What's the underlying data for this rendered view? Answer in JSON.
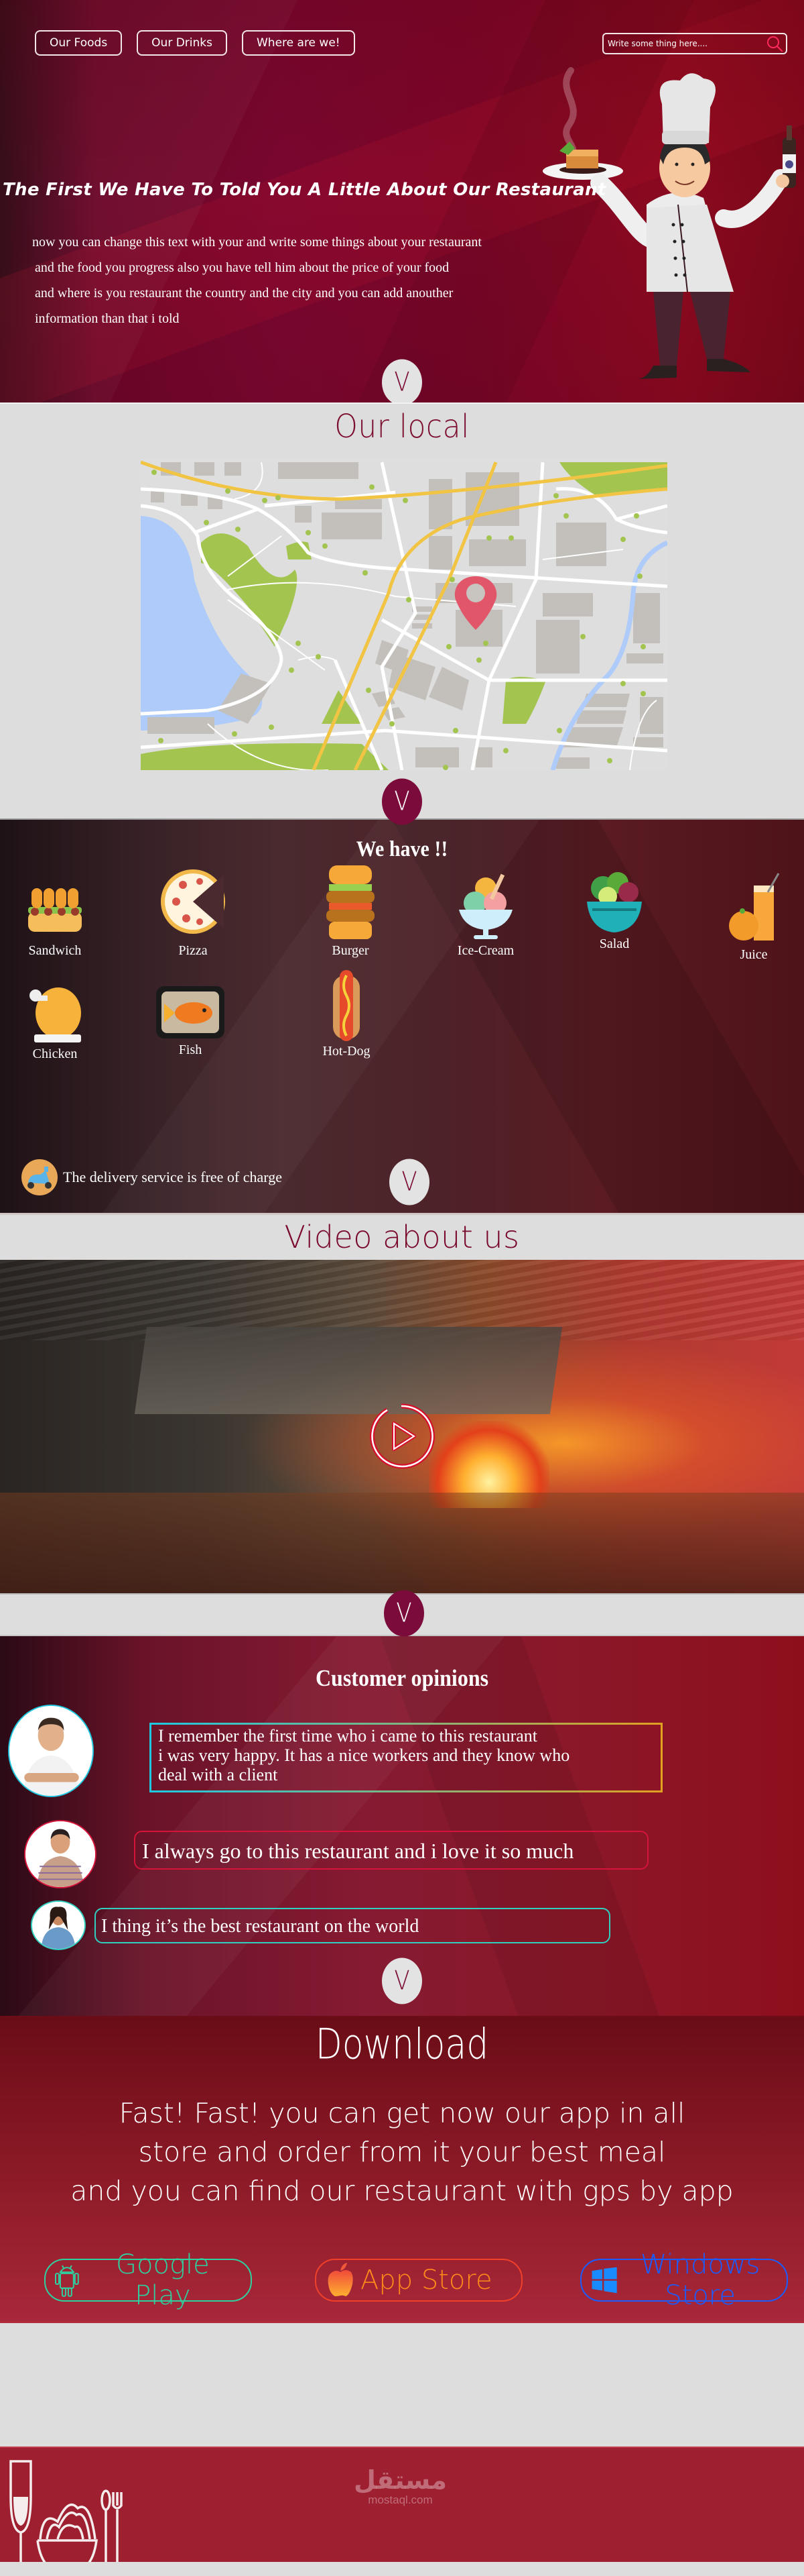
{
  "colors": {
    "brand_dark": "#7a0b3a",
    "title_dark": "#7d1030",
    "section_gray": "#dddddd",
    "footer_red": "#9e2030",
    "google_play": "#2fd0a0",
    "app_store_start": "#ff9f1a",
    "app_store_end": "#e8203a",
    "windows_store": "#1a5cff"
  },
  "nav": {
    "items": [
      {
        "label": "Our Foods"
      },
      {
        "label": "Our Drinks"
      },
      {
        "label": "Where are we!"
      }
    ]
  },
  "search": {
    "placeholder": "Write some thing here....",
    "value": "",
    "icon": "search-icon"
  },
  "hero": {
    "title": "The First We Have To Told You A Little About Our Restaurant",
    "paragraph": [
      "now you can change this text with your and write some things about your restaurant",
      "and the food you progress also you have tell him about the price of your food",
      "and where is you restaurant the country and the city and you can add anouther",
      "information than that i told"
    ],
    "illustration": "chef-icon"
  },
  "scroll_button": {
    "glyph": "V"
  },
  "local": {
    "title": "Our local",
    "map": "city-map",
    "pin": "location-pin-icon"
  },
  "menu": {
    "title": "We have !!",
    "items": [
      {
        "label": "Sandwich",
        "icon": "sandwich-icon"
      },
      {
        "label": "Pizza",
        "icon": "pizza-icon"
      },
      {
        "label": "Burger",
        "icon": "burger-icon"
      },
      {
        "label": "Ice-Cream",
        "icon": "ice-cream-icon"
      },
      {
        "label": "Salad",
        "icon": "salad-icon"
      },
      {
        "label": "Juice",
        "icon": "juice-icon"
      },
      {
        "label": "Chicken",
        "icon": "chicken-icon"
      },
      {
        "label": "Fish",
        "icon": "fish-icon"
      },
      {
        "label": "Hot-Dog",
        "icon": "hot-dog-icon"
      }
    ],
    "delivery": {
      "text": "The delivery service is free of charge",
      "icon": "scooter-icon"
    }
  },
  "video": {
    "title": "Video about us",
    "play_icon": "play-icon"
  },
  "opinions": {
    "title": "Customer opinions",
    "items": [
      {
        "lines": [
          "I remember the first time who i came to this restaurant",
          "i was very happy. It has a nice workers and they know who",
          "deal with a client"
        ]
      },
      {
        "lines": [
          "I always go to this restaurant and i love it so much"
        ]
      },
      {
        "lines": [
          "I thing it’s the best restaurant on the world"
        ]
      }
    ]
  },
  "download": {
    "title": "Download",
    "text": [
      "Fast! Fast! you can get now our app in all",
      "store and order from it your best meal",
      "and you can find our restaurant with gps by app"
    ],
    "stores": [
      {
        "label": "Google Play",
        "icon": "android-icon"
      },
      {
        "label": "App Store",
        "icon": "apple-icon"
      },
      {
        "label": "Windows Store",
        "icon": "windows-icon"
      }
    ]
  },
  "footer": {
    "watermark_ar": "مستقل",
    "watermark_en": "mostaql.com"
  }
}
